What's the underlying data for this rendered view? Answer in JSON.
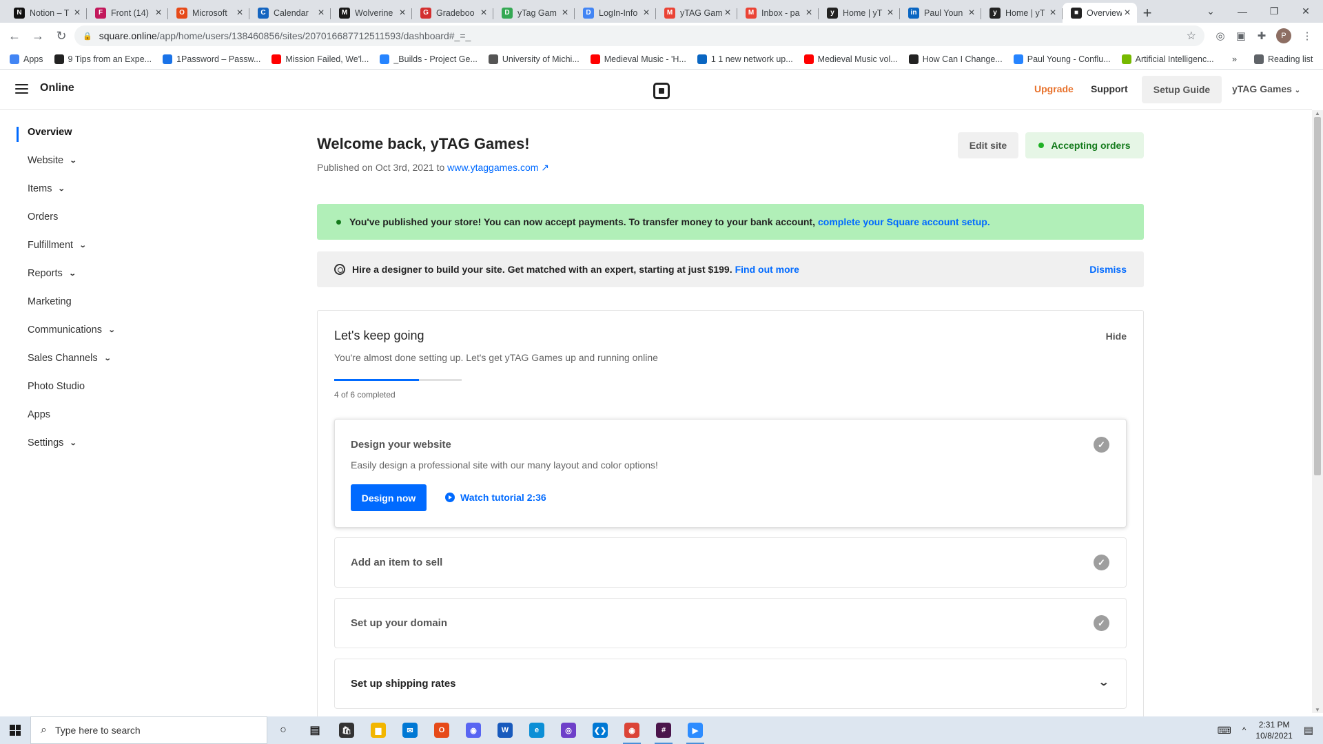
{
  "browser": {
    "tabs": [
      {
        "title": "Notion – T",
        "color": "#111111",
        "glyph": "N"
      },
      {
        "title": "Front (14)",
        "color": "#c2185b",
        "glyph": "F"
      },
      {
        "title": "Microsoft",
        "color": "#e64a19",
        "glyph": "O"
      },
      {
        "title": "Calendar",
        "color": "#1565c0",
        "glyph": "C"
      },
      {
        "title": "Wolverine",
        "color": "#1a1a1a",
        "glyph": "M"
      },
      {
        "title": "Gradeboo",
        "color": "#d32f2f",
        "glyph": "G"
      },
      {
        "title": "yTag Gam",
        "color": "#34a853",
        "glyph": "D"
      },
      {
        "title": "LogIn-Info",
        "color": "#4285f4",
        "glyph": "D"
      },
      {
        "title": "yTAG Gam",
        "color": "#ea4335",
        "glyph": "M"
      },
      {
        "title": "Inbox - pa",
        "color": "#ea4335",
        "glyph": "M"
      },
      {
        "title": "Home | yT",
        "color": "#222222",
        "glyph": "y"
      },
      {
        "title": "Paul Youn",
        "color": "#0a66c2",
        "glyph": "in"
      },
      {
        "title": "Home | yT",
        "color": "#222222",
        "glyph": "y"
      },
      {
        "title": "Overview",
        "color": "#222222",
        "glyph": "■",
        "active": true
      }
    ],
    "url_host": "square.online",
    "url_path": "/app/home/users/138460856/sites/207016687712511593/dashboard#_=_",
    "bookmarks": [
      {
        "label": "Apps",
        "color": "#4285f4"
      },
      {
        "label": "9 Tips from an Expe...",
        "color": "#222222"
      },
      {
        "label": "1Password – Passw...",
        "color": "#1a73e8"
      },
      {
        "label": "Mission Failed, We'l...",
        "color": "#ff0000"
      },
      {
        "label": "_Builds - Project Ge...",
        "color": "#2684ff"
      },
      {
        "label": "University of Michi...",
        "color": "#555555"
      },
      {
        "label": "Medieval Music - 'H...",
        "color": "#ff0000"
      },
      {
        "label": "1 1 new network up...",
        "color": "#0a66c2"
      },
      {
        "label": "Medieval Music vol...",
        "color": "#ff0000"
      },
      {
        "label": "How Can I Change...",
        "color": "#222222"
      },
      {
        "label": "Paul Young - Conflu...",
        "color": "#2684ff"
      },
      {
        "label": "Artificial Intelligenc...",
        "color": "#76b900"
      }
    ],
    "reading_list": "Reading list"
  },
  "header": {
    "brand": "Online",
    "upgrade": "Upgrade",
    "support": "Support",
    "setup_guide": "Setup Guide",
    "account": "yTAG Games"
  },
  "sidebar": {
    "items": [
      {
        "label": "Overview",
        "active": true,
        "chevron": false
      },
      {
        "label": "Website",
        "chevron": true
      },
      {
        "label": "Items",
        "chevron": true
      },
      {
        "label": "Orders",
        "chevron": false
      },
      {
        "label": "Fulfillment",
        "chevron": true
      },
      {
        "label": "Reports",
        "chevron": true
      },
      {
        "label": "Marketing",
        "chevron": false
      },
      {
        "label": "Communications",
        "chevron": true
      },
      {
        "label": "Sales Channels",
        "chevron": true
      },
      {
        "label": "Photo Studio",
        "chevron": false
      },
      {
        "label": "Apps",
        "chevron": false
      },
      {
        "label": "Settings",
        "chevron": true
      }
    ]
  },
  "main": {
    "welcome": "Welcome back, yTAG Games!",
    "published_prefix": "Published on Oct 3rd, 2021 to",
    "site_link": "www.ytaggames.com",
    "edit_site": "Edit site",
    "accepting_orders": "Accepting orders",
    "banner_success": "You've published your store! You can now accept payments. To transfer money to your bank account,",
    "banner_success_link": "complete your Square account setup.",
    "banner_designer": "Hire a designer to build your site. Get matched with an expert, starting at just $199.",
    "banner_designer_link": "Find out more",
    "dismiss": "Dismiss",
    "setup": {
      "title": "Let's keep going",
      "hide": "Hide",
      "subtitle": "You're almost done setting up. Let's get yTAG Games up and running online",
      "progress_text": "4 of 6 completed",
      "progress_fraction": 0.667,
      "tasks": [
        {
          "name": "Design your website",
          "desc": "Easily design a professional site with our many layout and color options!",
          "primary": "Design now",
          "secondary": "Watch tutorial 2:36",
          "done": true
        },
        {
          "name": "Add an item to sell",
          "done": true
        },
        {
          "name": "Set up your domain",
          "done": true
        },
        {
          "name": "Set up shipping rates",
          "done": false
        }
      ]
    }
  },
  "taskbar": {
    "search_placeholder": "Type here to search",
    "time": "2:31 PM",
    "date": "10/8/2021",
    "apps": [
      {
        "name": "cortana-icon",
        "color": "#222222",
        "glyph": "○"
      },
      {
        "name": "task-view-icon",
        "color": "#222222",
        "glyph": "▤"
      },
      {
        "name": "store-icon",
        "color": "#333333",
        "glyph": "🛍"
      },
      {
        "name": "file-explorer-icon",
        "color": "#f2b600",
        "glyph": "▆"
      },
      {
        "name": "mail-icon",
        "color": "#0078d4",
        "glyph": "✉"
      },
      {
        "name": "office-icon",
        "color": "#e64a19",
        "glyph": "O"
      },
      {
        "name": "discord-icon",
        "color": "#5865f2",
        "glyph": "◉"
      },
      {
        "name": "word-icon",
        "color": "#185abd",
        "glyph": "W"
      },
      {
        "name": "edge-icon",
        "color": "#0c8fd6",
        "glyph": "e"
      },
      {
        "name": "github-icon",
        "color": "#6e40c9",
        "glyph": "◎"
      },
      {
        "name": "vscode-icon",
        "color": "#0078d4",
        "glyph": "❮❯"
      },
      {
        "name": "chrome-icon",
        "color": "#db4437",
        "glyph": "◉",
        "open": true
      },
      {
        "name": "slack-icon",
        "color": "#4a154b",
        "glyph": "#",
        "open": true
      },
      {
        "name": "zoom-icon",
        "color": "#2d8cff",
        "glyph": "▶",
        "open": true
      }
    ]
  }
}
